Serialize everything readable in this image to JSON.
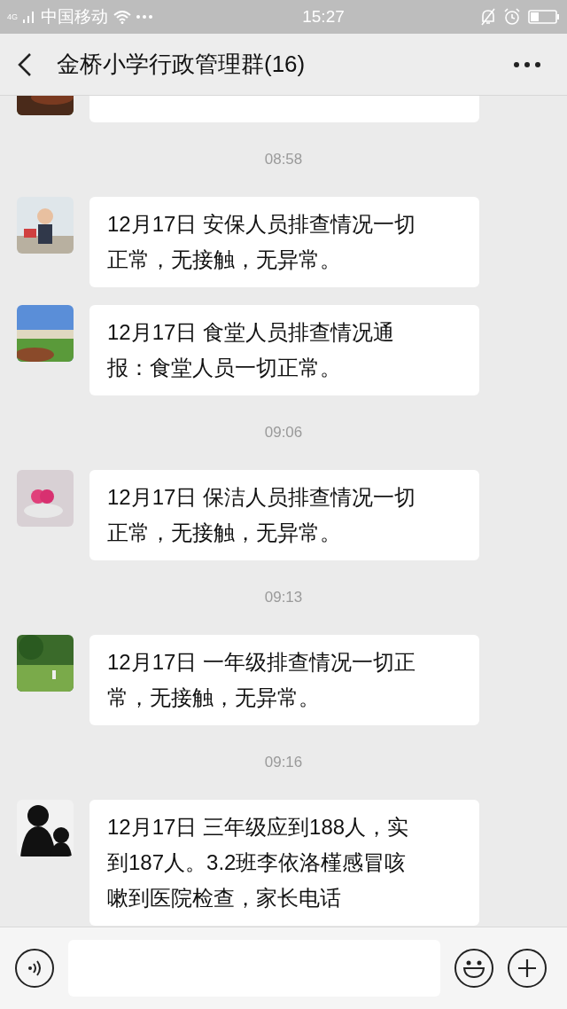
{
  "status_bar": {
    "carrier": "中国移动",
    "time": "15:27",
    "network": "4G"
  },
  "header": {
    "title": "金桥小学行政管理群(16)"
  },
  "messages": [
    {
      "kind": "message"
    },
    {
      "kind": "time",
      "text": "08:58"
    },
    {
      "kind": "message",
      "lines": [
        "12月17日 安保人员排查情况一切",
        "正常，无接触，无异常。"
      ]
    },
    {
      "kind": "message",
      "lines": [
        "12月17日  食堂人员排查情况通",
        "报：食堂人员一切正常。"
      ]
    },
    {
      "kind": "time",
      "text": "09:06"
    },
    {
      "kind": "message",
      "lines": [
        "12月17日 保洁人员排查情况一切",
        "正常，无接触，无异常。"
      ]
    },
    {
      "kind": "time",
      "text": "09:13"
    },
    {
      "kind": "message",
      "lines": [
        "12月17日  一年级排查情况一切正",
        "常，无接触，无异常。"
      ]
    },
    {
      "kind": "time",
      "text": "09:16"
    },
    {
      "kind": "message",
      "lines": [
        "12月17日 三年级应到188人，实",
        "到187人。3.2班李依洛槿感冒咳",
        "嗽到医院检查，家长电话"
      ]
    }
  ]
}
